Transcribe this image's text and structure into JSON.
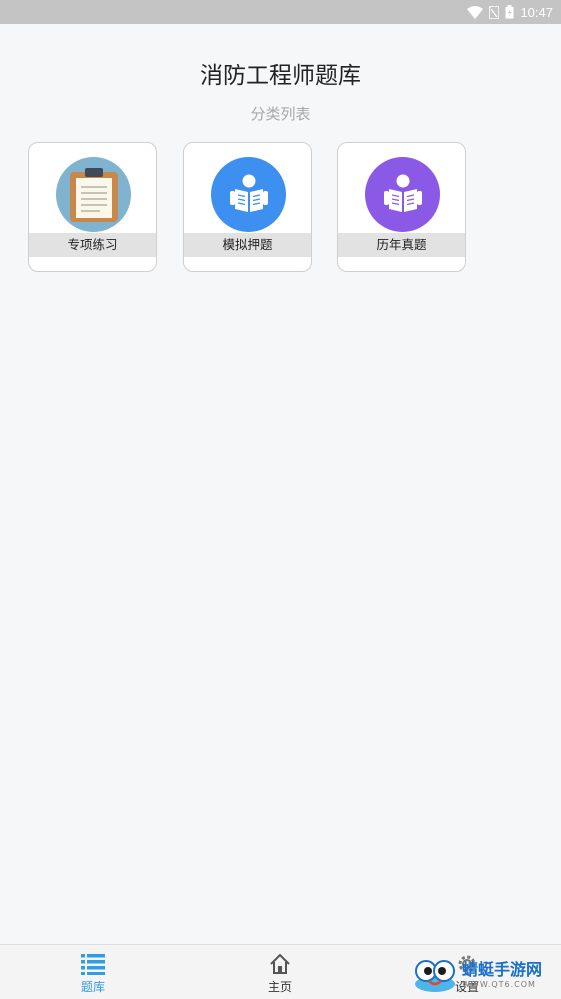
{
  "status_bar": {
    "time": "10:47",
    "icons": [
      "wifi-icon",
      "sim-icon",
      "battery-icon"
    ]
  },
  "header": {
    "title": "消防工程师题库",
    "subtitle": "分类列表"
  },
  "categories": [
    {
      "label": "专项练习",
      "icon": "clipboard-icon",
      "color": "#7fb3d0"
    },
    {
      "label": "模拟押题",
      "icon": "reader-icon",
      "color": "#3d90ef"
    },
    {
      "label": "历年真题",
      "icon": "reader-icon",
      "color": "#8a5ae6"
    }
  ],
  "tab_bar": {
    "tabs": [
      {
        "label": "题库",
        "icon": "list-icon",
        "active": true,
        "color": "#2f9de0"
      },
      {
        "label": "主页",
        "icon": "home-icon",
        "active": false,
        "color": "#333333"
      },
      {
        "label": "设置",
        "icon": "gear-icon",
        "active": false,
        "color": "#333333"
      }
    ]
  },
  "watermark": {
    "name": "蜻蜓手游网",
    "url": "WWW.QT6.COM"
  }
}
